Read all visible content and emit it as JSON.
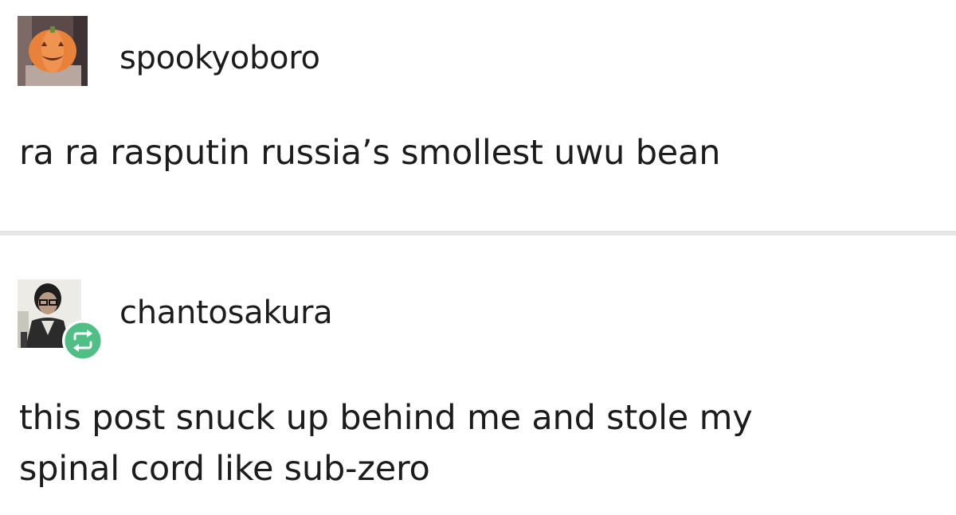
{
  "posts": [
    {
      "username": "spookyoboro",
      "avatar_icon": "pumpkin-avatar-icon",
      "text_lines": [
        "ra ra rasputin russia’s smollest uwu bean"
      ]
    },
    {
      "username": "chantosakura",
      "avatar_icon": "person-photo-avatar-icon",
      "badge_icon": "reblog-icon",
      "text_lines": [
        "this post snuck up behind me and stole my",
        "spinal cord like sub-zero"
      ]
    }
  ],
  "colors": {
    "background": "#ffffff",
    "text": "#1c1c1c",
    "divider": "#e7e7e7",
    "reblog_badge": "#4fbf86",
    "pumpkin": "#e8823a"
  }
}
